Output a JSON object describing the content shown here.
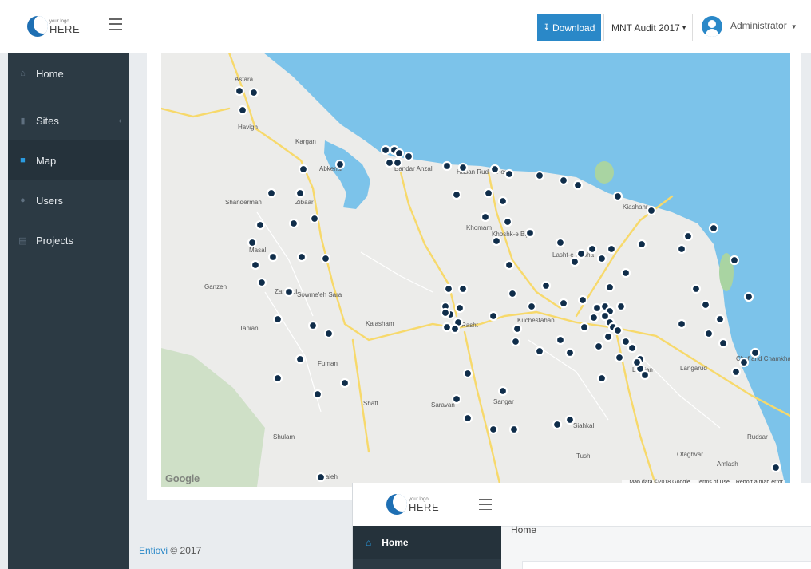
{
  "header": {
    "logo_small": "your logo",
    "logo_big": "HERE",
    "download_label": "Download",
    "audit_select_value": "MNT Audit 2017",
    "user_name": "Administrator"
  },
  "sidebar": {
    "items": [
      {
        "label": "Home",
        "icon": "home-icon"
      },
      {
        "label": "Sites",
        "icon": "bar-chart-icon"
      },
      {
        "label": "Map",
        "icon": "map-icon"
      },
      {
        "label": "Users",
        "icon": "users-icon"
      },
      {
        "label": "Projects",
        "icon": "document-icon"
      }
    ],
    "active": "Map"
  },
  "map": {
    "google_label": "Google",
    "attribution": "Map data ©2018 Google",
    "terms": "Terms of Use",
    "report": "Report a map error",
    "water_color": "#7cc3ea",
    "marker_color": "#0f2d4a",
    "road_color": "#f7d96b",
    "place_labels": [
      "Astara",
      "Havigh",
      "Kargan",
      "Abkenar",
      "Bandar Anzali",
      "Hasan Rud",
      "Posht",
      "Shanderman",
      "Zibaar",
      "Masal",
      "Sowme'eh Sara",
      "Zamoldi",
      "Ganzen",
      "Tanian",
      "Kalasham",
      "Rasht",
      "Khomam",
      "Khoshk-e Bijar",
      "Lasht-e Nesha",
      "Kiashahr",
      "Lahijan",
      "Langarud",
      "Kuchesfahan",
      "Fuman",
      "Shaft",
      "Saravan",
      "Sangar",
      "Siahkal",
      "Tush",
      "Otaghvar",
      "Amlash",
      "Shulam",
      "Daleh",
      "Rudsar",
      "Chaf and Chamkhaleh"
    ],
    "water_labels": []
  },
  "footer": {
    "brand": "Entiovi",
    "suffix": " © 2017"
  },
  "inset": {
    "logo_small": "your logo",
    "logo_big": "HERE",
    "breadcrumb": "Home",
    "nav_label": "Home"
  }
}
